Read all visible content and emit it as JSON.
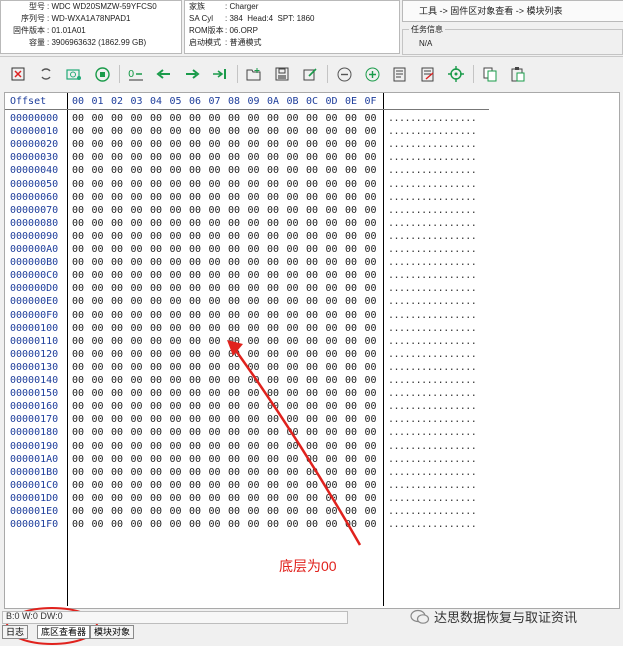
{
  "info": {
    "model_label": "型号",
    "model": "WDC WD20SMZW-59YFCS0",
    "serial_label": "序列号",
    "serial": "WD-WXA1A78NPAD1",
    "firmware_label": "固件版本",
    "firmware": "01.01A01",
    "capacity_label": "容量",
    "capacity": "3906963632 (1862.99 GB)",
    "family_label": "家族",
    "family": "Charger",
    "sacyl_label": "SA Cyl",
    "sacyl": "384",
    "head_label": "Head:",
    "head": "4",
    "spt_label": "SPT:",
    "spt": "1860",
    "rom_label": "ROM版本",
    "rom": "06.ORP",
    "boot_label": "启动模式",
    "boot": "普通模式",
    "path": "工具 -> 固件区对象查看 -> 模块列表",
    "task_title": "任务信息",
    "task_value": "N/A"
  },
  "toolbar": {
    "icons": [
      "delete-icon",
      "reload-icon",
      "camera-icon",
      "stop-icon",
      "step-icon",
      "arrow-left-icon",
      "arrow-right-icon",
      "jump-icon",
      "open-folder-icon",
      "save-icon",
      "edit-icon",
      "zoom-out-icon",
      "zoom-in-icon",
      "report-icon",
      "report-edit-icon",
      "target-icon",
      "copy-icon",
      "paste-icon"
    ]
  },
  "hex": {
    "offset_header": "Offset",
    "columns": [
      "00",
      "01",
      "02",
      "03",
      "04",
      "05",
      "06",
      "07",
      "08",
      "09",
      "0A",
      "0B",
      "0C",
      "0D",
      "0E",
      "0F"
    ],
    "rows": [
      "00000000",
      "00000010",
      "00000020",
      "00000030",
      "00000040",
      "00000050",
      "00000060",
      "00000070",
      "00000080",
      "00000090",
      "000000A0",
      "000000B0",
      "000000C0",
      "000000D0",
      "000000E0",
      "000000F0",
      "00000100",
      "00000110",
      "00000120",
      "00000130",
      "00000140",
      "00000150",
      "00000160",
      "00000170",
      "00000180",
      "00000190",
      "000001A0",
      "000001B0",
      "000001C0",
      "000001D0",
      "000001E0",
      "000001F0"
    ],
    "byte_value": "00",
    "ascii": "................"
  },
  "status": {
    "text": "B:0 W:0 DW:0"
  },
  "tabs": [
    "日志",
    "底区查看器",
    "模块对象"
  ],
  "annotation": {
    "text": "底层为00",
    "color": "#e0221d"
  },
  "watermark": {
    "text": "达思数据恢复与取证资讯"
  }
}
